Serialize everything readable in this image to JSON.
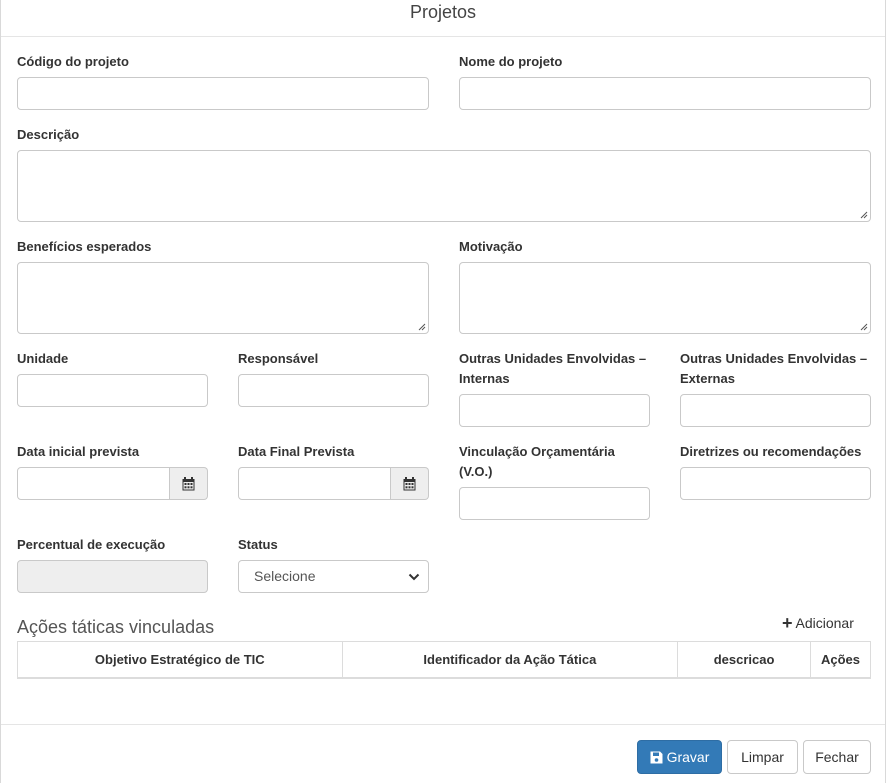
{
  "header": {
    "title": "Projetos"
  },
  "fields": {
    "codigo": {
      "label": "Código do projeto",
      "value": ""
    },
    "nome": {
      "label": "Nome do projeto",
      "value": ""
    },
    "descricao": {
      "label": "Descrição",
      "value": ""
    },
    "beneficios": {
      "label": "Benefícios esperados",
      "value": ""
    },
    "motivacao": {
      "label": "Motivação",
      "value": ""
    },
    "unidade": {
      "label": "Unidade",
      "value": ""
    },
    "responsavel": {
      "label": "Responsável",
      "value": ""
    },
    "outras_internas": {
      "label_line1": "Outras Unidades Envolvidas –",
      "label_line2": "Internas",
      "value": ""
    },
    "outras_externas": {
      "label_line1": "Outras Unidades Envolvidas –",
      "label_line2": "Externas",
      "value": ""
    },
    "data_inicial": {
      "label": "Data inicial prevista",
      "value": ""
    },
    "data_final": {
      "label": "Data Final Prevista",
      "value": ""
    },
    "vinculacao": {
      "label_line1": "Vinculação Orçamentária",
      "label_line2": "(V.O.)",
      "value": ""
    },
    "diretrizes": {
      "label": "Diretrizes ou recomendações",
      "value": ""
    },
    "percentual": {
      "label": "Percentual de execução",
      "value": ""
    },
    "status": {
      "label": "Status",
      "selected": "Selecione"
    }
  },
  "acoes": {
    "title": "Ações táticas vinculadas",
    "add_label": "Adicionar",
    "columns": [
      "Objetivo Estratégico de TIC",
      "Identificador da Ação Tática",
      "descricao",
      "Ações"
    ],
    "rows": []
  },
  "footer": {
    "save_label": "Gravar",
    "clear_label": "Limpar",
    "close_label": "Fechar"
  },
  "colors": {
    "primary": "#337ab7",
    "border": "#c9c9c9",
    "disabled": "#eeeeee"
  },
  "icons": {
    "calendar": "calendar-icon",
    "save": "floppy-disk-icon",
    "add": "plus-icon",
    "dropdown": "chevron-down-icon"
  }
}
